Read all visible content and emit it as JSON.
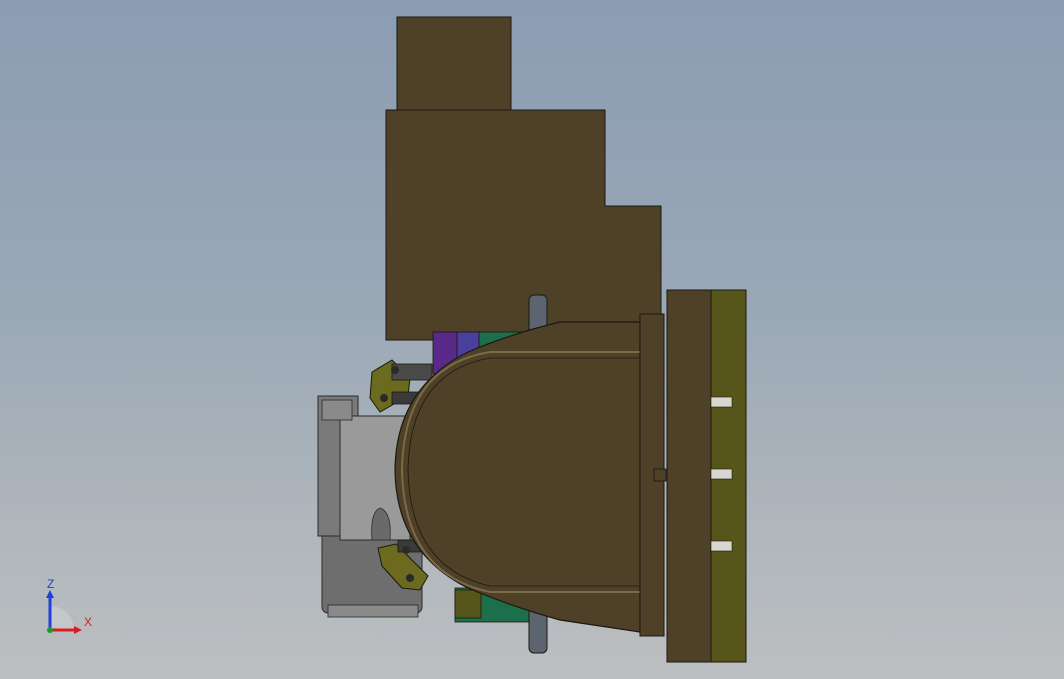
{
  "viewport": {
    "background_top": "#8b9db3",
    "background_bottom": "#bcbfc1"
  },
  "model": {
    "colors": {
      "housing": "#4e4128",
      "housing_dark": "#3a3020",
      "flange_plate": "#57561a",
      "edge": "#1a1810",
      "throttle_body": "#6e6e6e",
      "throttle_light": "#9a9a9a",
      "clamp": "#6b6a1f",
      "purple": "#5a2a8a",
      "blue_violet": "#4a3f9a",
      "green": "#1d6e4a",
      "pin": "#5c6470"
    }
  },
  "triad": {
    "z_label": "Z",
    "x_label": "X",
    "z_color": "#1f3fd8",
    "x_color": "#d81f1f",
    "y_color": "#1f9a2a"
  }
}
